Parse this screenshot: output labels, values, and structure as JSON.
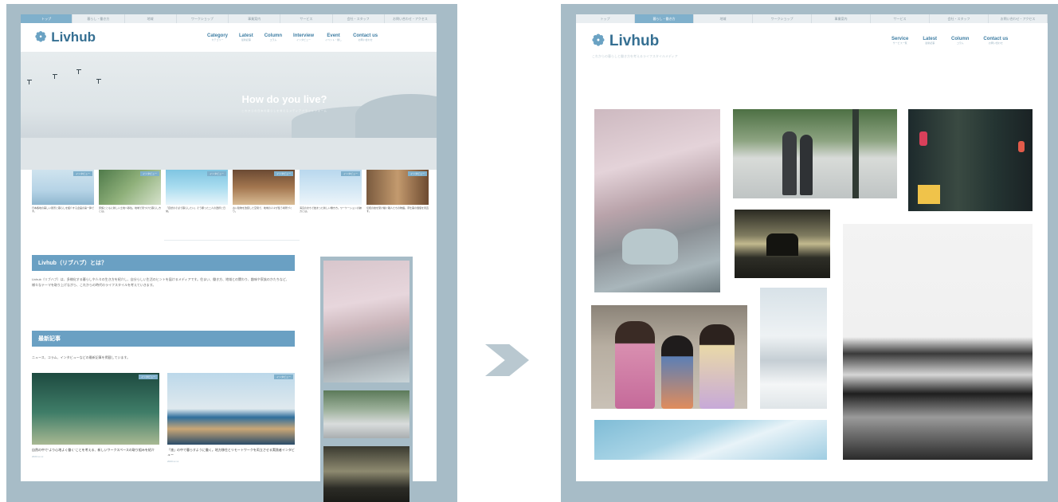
{
  "left_site": {
    "topnav_tabs": [
      "トップ",
      "暮らし・働き方",
      "地域",
      "ワークショップ",
      "事業案内",
      "サービス",
      "会社・スタッフ",
      "お問い合わせ・アクセス"
    ],
    "logo_text": "Livhub",
    "logo_symbol": "❁",
    "menu": [
      {
        "en": "Category",
        "jp": "カテゴリー"
      },
      {
        "en": "Latest",
        "jp": "最新記事"
      },
      {
        "en": "Column",
        "jp": "コラム"
      },
      {
        "en": "Interview",
        "jp": "インタビュー"
      },
      {
        "en": "Event",
        "jp": "イベント・催し"
      },
      {
        "en": "Contact us",
        "jp": "お問い合わせ"
      }
    ],
    "hero": {
      "title": "How do you live?",
      "subtitle": "これからの日本の暮らしを考えるメディアプラットフォーム"
    },
    "articles": [
      {
        "badge": "インタビュー",
        "text": "日本各地の美しい風景と暮らしを紹介する企画の第一弾です。"
      },
      {
        "badge": "インタビュー",
        "text": "家族とともに新しい土地へ移住。地域で見つけた暮らし方とは。"
      },
      {
        "badge": "インタビュー",
        "text": "「自然のそばで暮らしたい」そう願った二人の選択と日常。"
      },
      {
        "badge": "インタビュー",
        "text": "古い建物を改装した空間で、地域の人々が集う場所づくり。"
      },
      {
        "badge": "インタビュー",
        "text": "海辺のまちで始まった新しい働き方。ワーケーションの魅力とは。"
      },
      {
        "badge": "インタビュー",
        "text": "伝統の技を受け継ぐ職人たちの物語。手仕事の価値を見直す。"
      }
    ],
    "about_heading": "Livhub（リブハブ）とは？",
    "about_text": "Livhub（リブハブ）は、多様化する暮らしや人々の生き方を紹介し、自分らしい生活のヒントを届けるメディアです。住まい、働き方、地域との関わり、趣味や家族のかたちなど、様々なテーマを取り上げながら、これからの時代のライフスタイルを考えていきます。",
    "latest_heading": "最新記事",
    "latest_text": "ニュース、コラム、インタビューなどの最新記事を掲載しています。",
    "cards": [
      {
        "badge": "インタビュー",
        "text": "自然の中で“より心地よく働く”ことを考える、新しいワークスペースの取り組みを紹介",
        "date": "2023.xx.xx"
      },
      {
        "badge": "インタビュー",
        "text": "「旅」の中で暮らすように働く。地方移住とリモートワークを両立させる実践者インタビュー",
        "date": "2023.xx.xx"
      }
    ]
  },
  "right_site": {
    "topnav_tabs": [
      "トップ",
      "暮らし・働き方",
      "地域",
      "ワークショップ",
      "事業案内",
      "サービス",
      "会社・スタッフ",
      "お問い合わせ・アクセス"
    ],
    "logo_text": "Livhub",
    "logo_symbol": "❁",
    "tagline": "これからの暮らしと働き方を考えるライフスタイルメディア",
    "menu": [
      {
        "en": "Service",
        "jp": "サービス一覧"
      },
      {
        "en": "Latest",
        "jp": "最新記事"
      },
      {
        "en": "Column",
        "jp": "コラム"
      },
      {
        "en": "Contact us",
        "jp": "お問い合わせ"
      }
    ]
  },
  "colors": {
    "frame": "#a7bcc7",
    "accent": "#6aa0c3",
    "logo": "#356f92",
    "tab_active": "#7fb0cc"
  },
  "icons": [
    "flower-logo-icon",
    "transition-chevron-icon"
  ]
}
